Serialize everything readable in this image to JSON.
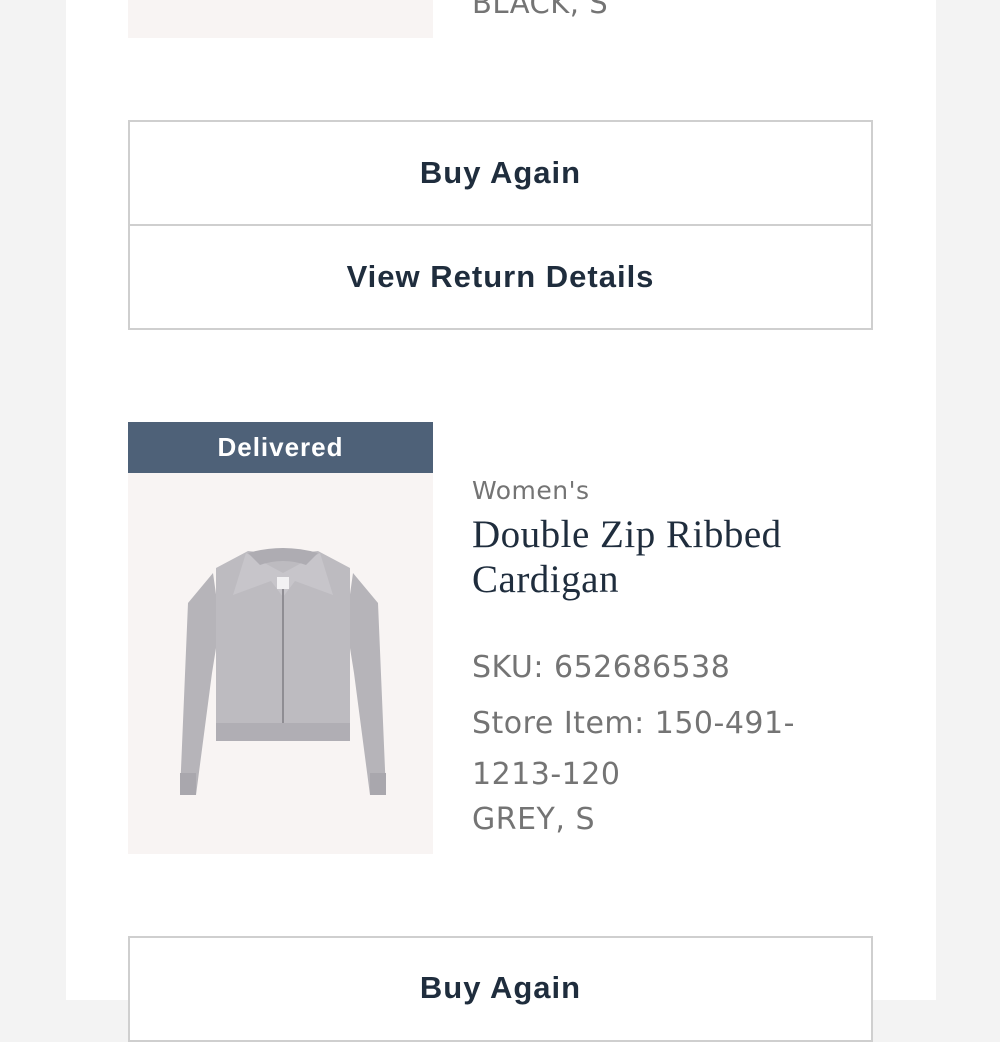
{
  "prev_item": {
    "variant": "BLACK, S"
  },
  "prev_actions": {
    "buy_again_label": "Buy Again",
    "view_return_label": "View Return Details"
  },
  "item": {
    "status": "Delivered",
    "category": "Women's",
    "name_line1": "Double Zip Ribbed",
    "name_line2": "Cardigan",
    "sku": "SKU: 652686538",
    "store_item_line1": "Store Item: 150-491-",
    "store_item_line2": "1213-120",
    "variant": "GREY, S",
    "image": "grey-cardigan-image"
  },
  "item_actions": {
    "buy_again_label": "Buy Again"
  },
  "colors": {
    "badge": "#4e6178",
    "text_dark": "#1f2d3d",
    "text_gray": "#747474"
  }
}
